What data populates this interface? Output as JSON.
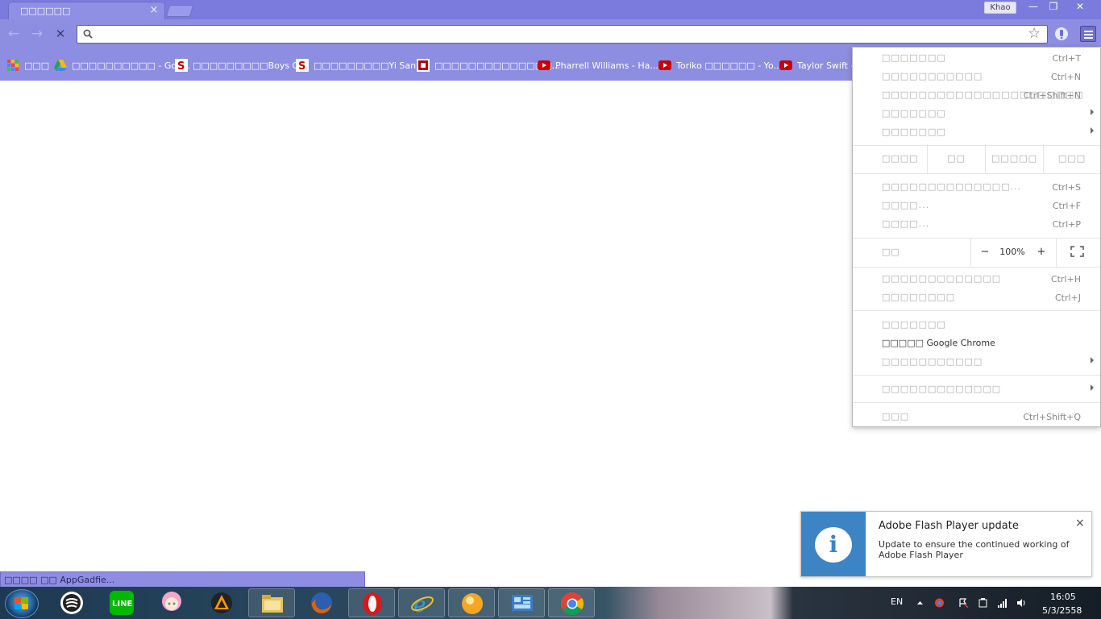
{
  "browser": {
    "tab_title": "□□□□□□",
    "tab_close": "×",
    "profile_name": "Khao",
    "window_controls": {
      "minimize": "—",
      "restore": "❐",
      "close": "✕"
    },
    "nav": {
      "back": "←",
      "forward": "→",
      "stop": "✕"
    },
    "omnibox_value": "",
    "omnibox_placeholder": "",
    "star": "☆"
  },
  "bookmarks": [
    {
      "label": "□□□",
      "icon": "apps-icon"
    },
    {
      "label": "□□□□□□□□□□ - Goo...",
      "icon": "drive-icon"
    },
    {
      "label": "□□□□□□□□□Boys O...",
      "icon": "site-s-icon"
    },
    {
      "label": "□□□□□□□□□Yi San ...",
      "icon": "site-s-icon"
    },
    {
      "label": "□□□□□□□□□□□□□□...",
      "icon": "site-red-icon"
    },
    {
      "label": "Pharrell Williams - Ha...",
      "icon": "youtube-icon"
    },
    {
      "label": "Toriko □□□□□□ - Yo...",
      "icon": "youtube-icon"
    },
    {
      "label": "Taylor Swift - S",
      "icon": "youtube-icon"
    }
  ],
  "menu": {
    "new_tab": {
      "label": "□□□□□□□",
      "shortcut": "Ctrl+T"
    },
    "new_window": {
      "label": "□□□□□□□□□□□",
      "shortcut": "Ctrl+N"
    },
    "new_incognito": {
      "label": "□□□□□□□□□□□□□□□□□□□□□□",
      "shortcut": "Ctrl+Shift+N"
    },
    "bookmarks": {
      "label": "□□□□□□□"
    },
    "recent_tabs": {
      "label": "□□□□□□□"
    },
    "edit": {
      "label": "□□□□",
      "cut": "□□",
      "copy": "□□□□□",
      "paste": "□□□"
    },
    "save_page": {
      "label": "□□□□□□□□□□□□□□...",
      "shortcut": "Ctrl+S"
    },
    "find": {
      "label": "□□□□...",
      "shortcut": "Ctrl+F"
    },
    "print": {
      "label": "□□□□...",
      "shortcut": "Ctrl+P"
    },
    "zoom": {
      "label": "□□",
      "minus": "−",
      "value": "100%",
      "plus": "+"
    },
    "history": {
      "label": "□□□□□□□□□□□□□",
      "shortcut": "Ctrl+H"
    },
    "downloads": {
      "label": "□□□□□□□□",
      "shortcut": "Ctrl+J"
    },
    "settings": {
      "label": "□□□□□□□"
    },
    "about": {
      "label": "□□□□□ Google Chrome"
    },
    "help": {
      "label": "□□□□□□□□□□□"
    },
    "more_tools": {
      "label": "□□□□□□□□□□□□□"
    },
    "exit": {
      "label": "□□□",
      "shortcut": "Ctrl+Shift+Q"
    }
  },
  "status_bar": "□□□□ □□ AppGadfie...",
  "notification": {
    "title": "Adobe Flash Player update",
    "body": "Update to ensure the continued working of Adobe Flash Player",
    "close": "×",
    "icon_glyph": "i"
  },
  "taskbar": {
    "apps": [
      "spotify-like-icon",
      "line-icon",
      "anime-avatar-icon",
      "vlc-icon",
      "explorer-icon",
      "firefox-icon",
      "opera-icon",
      "ie-icon",
      "media-icon",
      "control-panel-icon",
      "chrome-icon"
    ],
    "language": "EN",
    "time": "16:05",
    "date": "5/3/2558"
  },
  "colors": {
    "theme": "#8d8de2",
    "accent_flash": "#3c84c4"
  }
}
